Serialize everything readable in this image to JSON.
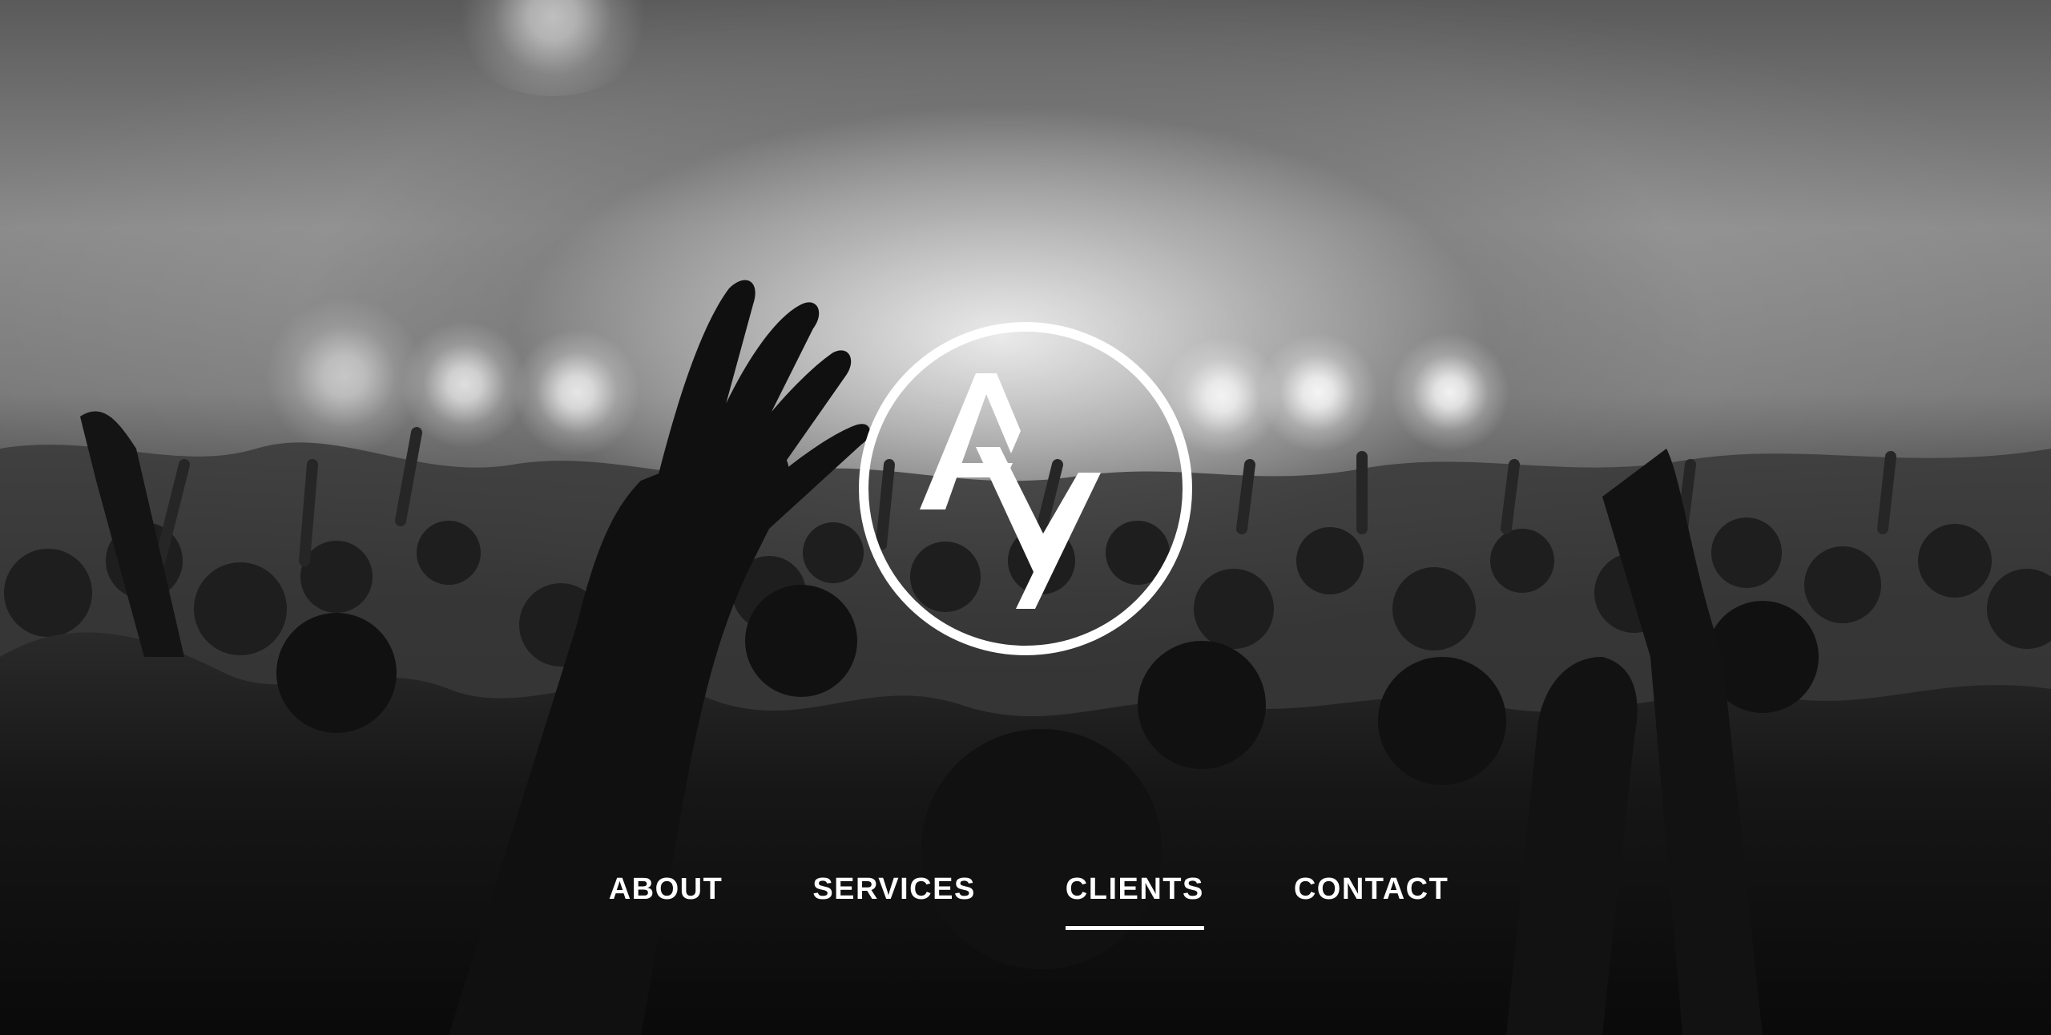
{
  "logo": {
    "letters": "AY",
    "icon": "ay-monogram-circle-icon",
    "color": "#ffffff"
  },
  "hero": {
    "image": "concert-crowd-hands-raised-photo",
    "tone": "black-and-white"
  },
  "nav": {
    "items": [
      {
        "label": "ABOUT",
        "active": false
      },
      {
        "label": "SERVICES",
        "active": false
      },
      {
        "label": "CLIENTS",
        "active": true
      },
      {
        "label": "CONTACT",
        "active": false
      }
    ],
    "text_color": "#ffffff",
    "underline_color": "#ffffff"
  }
}
